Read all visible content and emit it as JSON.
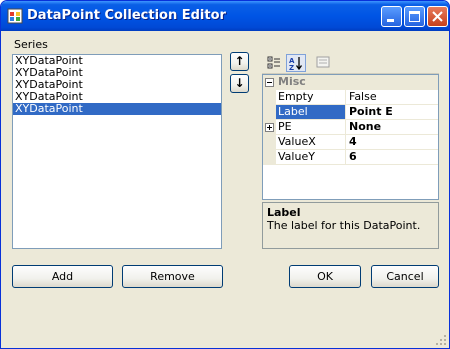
{
  "window": {
    "title": "DataPoint Collection Editor"
  },
  "series": {
    "label": "Series",
    "items": [
      "XYDataPoint",
      "XYDataPoint",
      "XYDataPoint",
      "XYDataPoint",
      "XYDataPoint"
    ],
    "selected_index": 4
  },
  "arrows": {
    "up": "↑",
    "down": "↓"
  },
  "grid": {
    "category": "Misc",
    "rows": [
      {
        "name": "Empty",
        "value": "False"
      },
      {
        "name": "Label",
        "value": "Point E"
      },
      {
        "name": "PE",
        "value": "None"
      },
      {
        "name": "ValueX",
        "value": "4"
      },
      {
        "name": "ValueY",
        "value": "6"
      }
    ]
  },
  "help": {
    "title": "Label",
    "description": "The label for this DataPoint."
  },
  "buttons": {
    "add": "Add",
    "remove": "Remove",
    "ok": "OK",
    "cancel": "Cancel"
  },
  "colors": {
    "titlebar": "#0055e5",
    "selection": "#316ac5",
    "dialog_bg": "#ece9d8"
  }
}
